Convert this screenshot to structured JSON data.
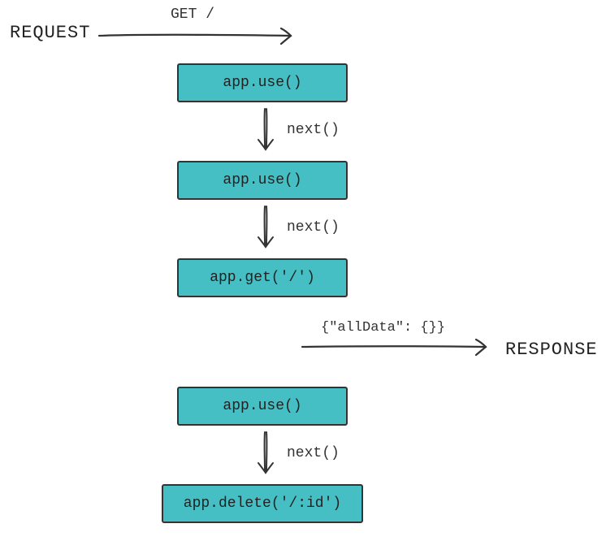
{
  "request_label": "REQUEST",
  "response_label": "RESPONSE",
  "request_arrow_label": "GET /",
  "response_arrow_label": "{\"allData\": {}}",
  "next_label_1": "next()",
  "next_label_2": "next()",
  "next_label_3": "next()",
  "boxes": {
    "b1": "app.use()",
    "b2": "app.use()",
    "b3": "app.get('/')",
    "b4": "app.use()",
    "b5": "app.delete('/:id')"
  }
}
